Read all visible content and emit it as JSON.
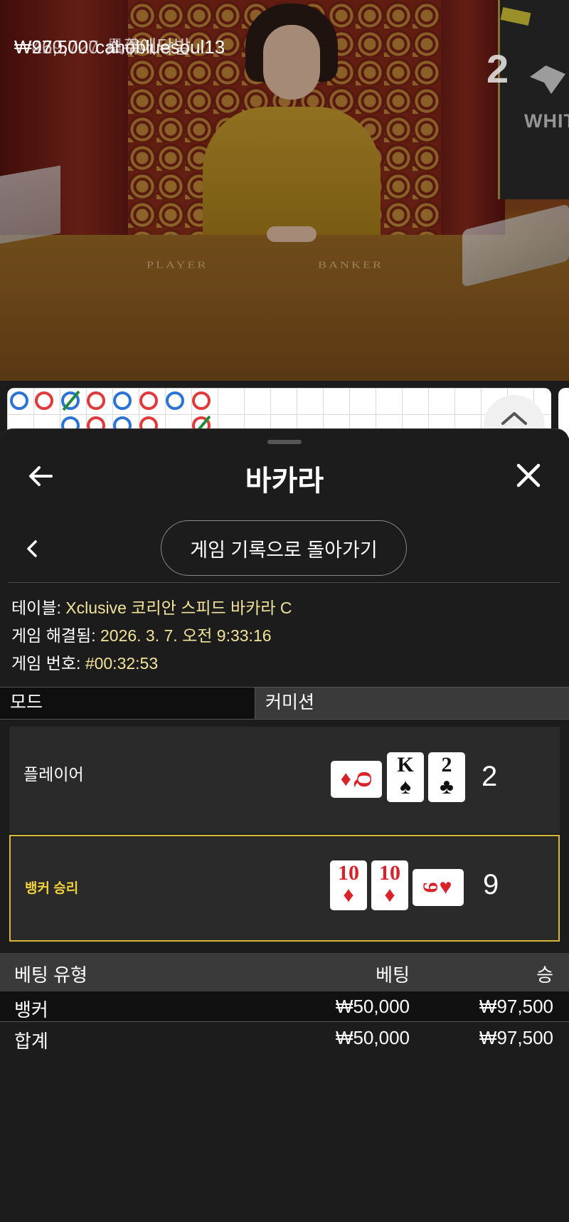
{
  "recent_winners": [
    {
      "amount": "₩429,727",
      "name": "具体"
    },
    {
      "amount": "₩260,000",
      "name": "소주에닥발"
    },
    {
      "amount": "₩97,500",
      "name": "cahobluesoul13"
    }
  ],
  "video": {
    "round_count": "2",
    "panel_text": "WHIT",
    "table_labels": {
      "player": "PLAYER",
      "banker": "BANKER"
    }
  },
  "sheet": {
    "title": "바카라",
    "back_to_history": "게임 기록으로 돌아가기"
  },
  "info": {
    "table_key": "테이블:",
    "table_value": "Xclusive 코리안 스피드 바카라 C",
    "resolved_key": "게임 해결됨:",
    "resolved_value": "2026. 3. 7. 오전 9:33:16",
    "number_key": "게임 번호:",
    "number_value": "#00:32:53"
  },
  "mode": {
    "label": "모드",
    "value": "커미션"
  },
  "hands": {
    "player": {
      "label": "플레이어",
      "score": "2",
      "cards": [
        {
          "rank": "Q",
          "suit": "♦",
          "color": "red",
          "orientation": "sideways"
        },
        {
          "rank": "K",
          "suit": "♠",
          "color": "black",
          "orientation": "upright"
        },
        {
          "rank": "2",
          "suit": "♣",
          "color": "black",
          "orientation": "upright"
        }
      ]
    },
    "banker": {
      "label": "뱅커 승리",
      "score": "9",
      "cards": [
        {
          "rank": "10",
          "suit": "♦",
          "color": "red",
          "orientation": "upright"
        },
        {
          "rank": "10",
          "suit": "♦",
          "color": "red",
          "orientation": "upright"
        },
        {
          "rank": "9",
          "suit": "♥",
          "color": "red",
          "orientation": "sideways"
        }
      ]
    }
  },
  "bets": {
    "headers": {
      "type": "베팅 유형",
      "bet": "베팅",
      "win": "승"
    },
    "rows": [
      {
        "type": "뱅커",
        "bet": "₩50,000",
        "win": "₩97,500"
      }
    ],
    "total": {
      "type": "합계",
      "bet": "₩50,000",
      "win": "₩97,500"
    }
  },
  "colors": {
    "accent_gold": "#f4d23c",
    "info_value": "#f2e39a",
    "banker_border": "#d6b82e",
    "card_red": "#d9212a"
  }
}
